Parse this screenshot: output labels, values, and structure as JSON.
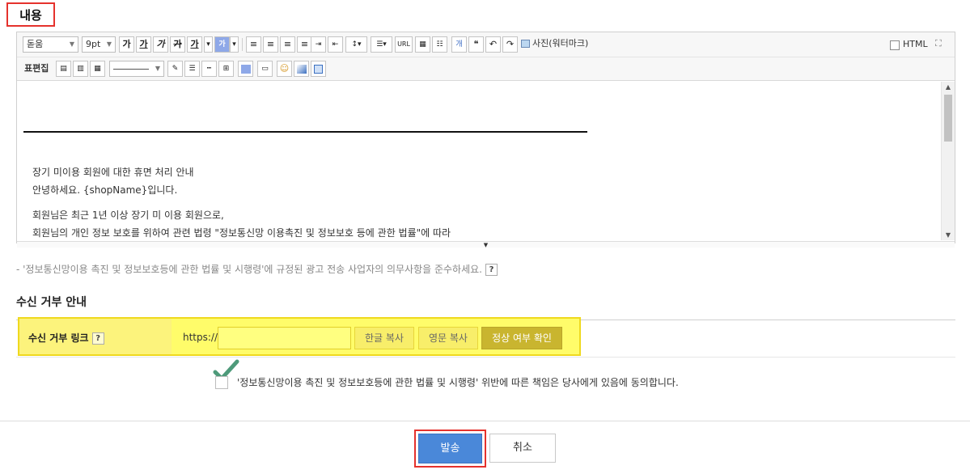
{
  "section": {
    "title": "내용"
  },
  "toolbar": {
    "font_family": "돋움",
    "font_size": "9pt",
    "bold": "가",
    "underline": "가",
    "italic": "가",
    "strike": "가",
    "font_color": "가",
    "bg_color": "가",
    "url_label": "URL",
    "photo_label": "사진(워터마크)",
    "html_label": "HTML",
    "table_edit_label": "표편집"
  },
  "content": {
    "line1": "장기 미이용 회원에 대한 휴면 처리 안내",
    "line2": "안녕하세요. {shopName}입니다.",
    "line3": "회원님은 최근 1년 이상 장기 미 이용 회원으로,",
    "line4": "회원님의 개인 정보 보호를 위하여 관련 법령 \"정보통신망 이용촉진 및 정보보호 등에 관한 법률\"에 따라"
  },
  "notice": {
    "text": "- '정보통신망이용 촉진 및 정보보호등에 관한 법률 및 시행령'에 규정된 광고 전송 사업자의 의무사항을 준수하세요.",
    "help": "?"
  },
  "reject": {
    "title": "수신 거부 안내",
    "link_label": "수신 거부 링크",
    "help": "?",
    "prefix": "https://",
    "url_value": "",
    "btn_korean": "한글 복사",
    "btn_english": "영문 복사",
    "btn_check": "정상 여부 확인"
  },
  "agree": {
    "text": "'정보통신망이용 촉진 및 정보보호등에 관한 법률 및 시행령' 위반에 따른 책임은 당사에게 있음에 동의합니다."
  },
  "footer": {
    "send": "발송",
    "cancel": "취소"
  },
  "colors": {
    "highlight": "#fffc6a",
    "accent_red": "#e5322d",
    "primary": "#4a88d9",
    "check_green": "#4e9a7a"
  }
}
